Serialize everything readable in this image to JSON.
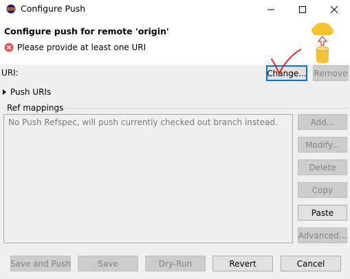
{
  "window": {
    "title": "Configure Push"
  },
  "header": {
    "title": "Configure push for remote 'origin'",
    "error_message": "Please provide at least one URI"
  },
  "uri": {
    "label": "URI:",
    "change_label": "Change...",
    "remove_label": "Remove"
  },
  "push_uris": {
    "label": "Push URIs",
    "expanded": false
  },
  "ref_mappings": {
    "label": "Ref mappings",
    "empty_text": "No Push Refspec, will push currently checked out branch instead.",
    "buttons": {
      "add": "Add...",
      "modify": "Modify...",
      "delete": "Delete",
      "copy": "Copy",
      "paste": "Paste",
      "advanced": "Advanced..."
    }
  },
  "footer": {
    "save_and_push": "Save and Push",
    "save": "Save",
    "dry_run": "Dry-Run",
    "revert": "Revert",
    "cancel": "Cancel"
  },
  "icons": {
    "app": "eclipse-icon",
    "error": "error-icon",
    "banner": "cloud-push-icon",
    "annotation": "red-checkmark"
  },
  "colors": {
    "error_red": "#e05550",
    "focus_blue": "#0078d7",
    "annotation_red": "#e8141b",
    "cloud_yellow": "#f6c232"
  }
}
